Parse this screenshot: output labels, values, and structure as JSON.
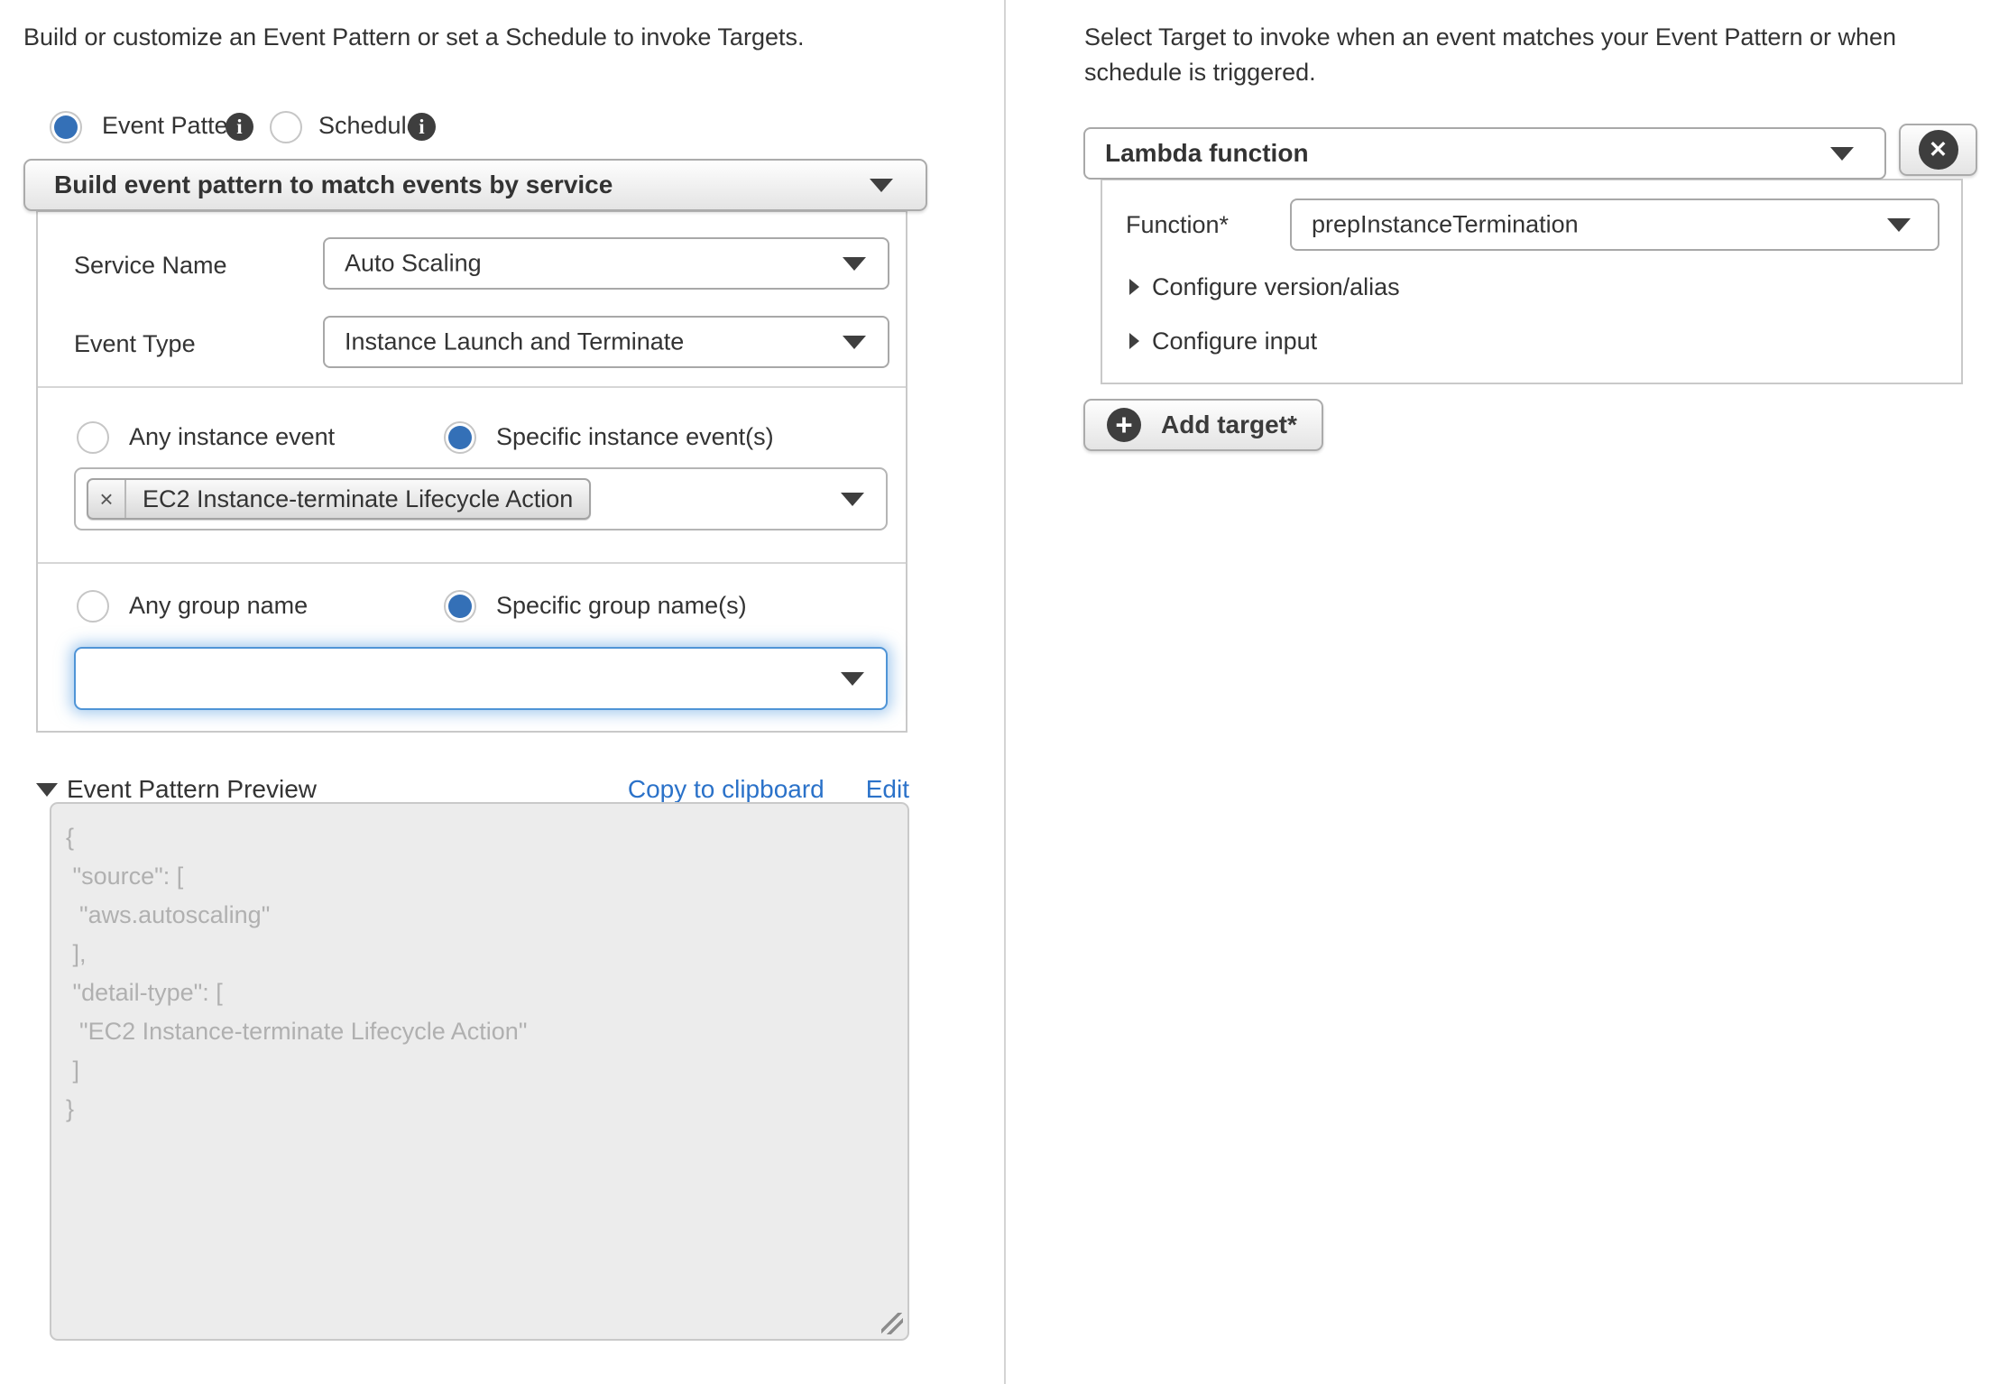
{
  "colors": {
    "accent_radio_blue": "#3470b7",
    "link_blue": "#2b72c9",
    "focus_border_blue": "#4f94d6",
    "body_text": "#333333",
    "preview_text_gray": "#b0b0b0",
    "preview_bg_gray": "#ececec"
  },
  "icons": {
    "info": "i",
    "remove_tag": "×",
    "close_circle": "✕",
    "plus_circle": "+"
  },
  "left": {
    "intro": "Build or customize an Event Pattern or set a Schedule to invoke Targets.",
    "event_pattern_label": "Event Pattern",
    "schedule_label": "Schedule",
    "pattern_builder_value": "Build event pattern to match events by service",
    "service_name_label": "Service Name",
    "service_name_value": "Auto Scaling",
    "event_type_label": "Event Type",
    "event_type_value": "Instance Launch and Terminate",
    "any_instance_event_label": "Any instance event",
    "specific_instance_event_label": "Specific instance event(s)",
    "instance_event_tag": "EC2 Instance-terminate Lifecycle Action",
    "any_group_name_label": "Any group name",
    "specific_group_name_label": "Specific group name(s)",
    "group_name_value": "",
    "preview_title": "Event Pattern Preview",
    "copy_label": "Copy to clipboard",
    "edit_label": "Edit",
    "preview_json": "{\n \"source\": [\n  \"aws.autoscaling\"\n ],\n \"detail-type\": [\n  \"EC2 Instance-terminate Lifecycle Action\"\n ]\n}"
  },
  "right": {
    "intro": "Select Target to invoke when an event matches your Event Pattern or when schedule is triggered.",
    "target_type_value": "Lambda function",
    "function_label": "Function*",
    "function_value": "prepInstanceTermination",
    "configure_version_alias_label": "Configure version/alias",
    "configure_input_label": "Configure input",
    "add_target_label": "Add target*"
  }
}
